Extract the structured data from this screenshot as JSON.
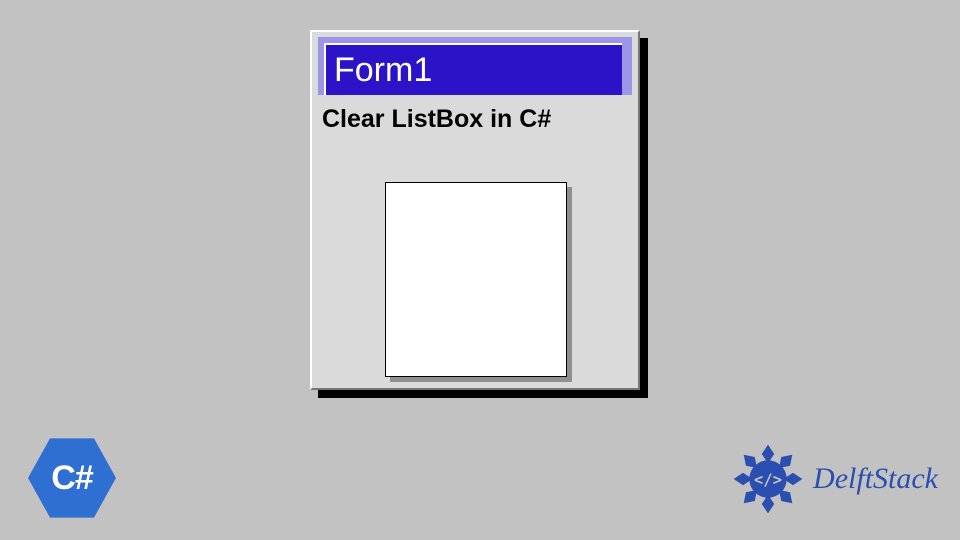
{
  "window": {
    "title": "Form1",
    "label": "Clear ListBox in C#"
  },
  "badges": {
    "csharp": "C#",
    "brand": "DelftStack"
  },
  "colors": {
    "titlebar": "#2b13c8",
    "titlebar_inactive": "#9a95e6",
    "csharp_hex": "#2f6fd1",
    "brand_blue": "#2a4fb0"
  }
}
